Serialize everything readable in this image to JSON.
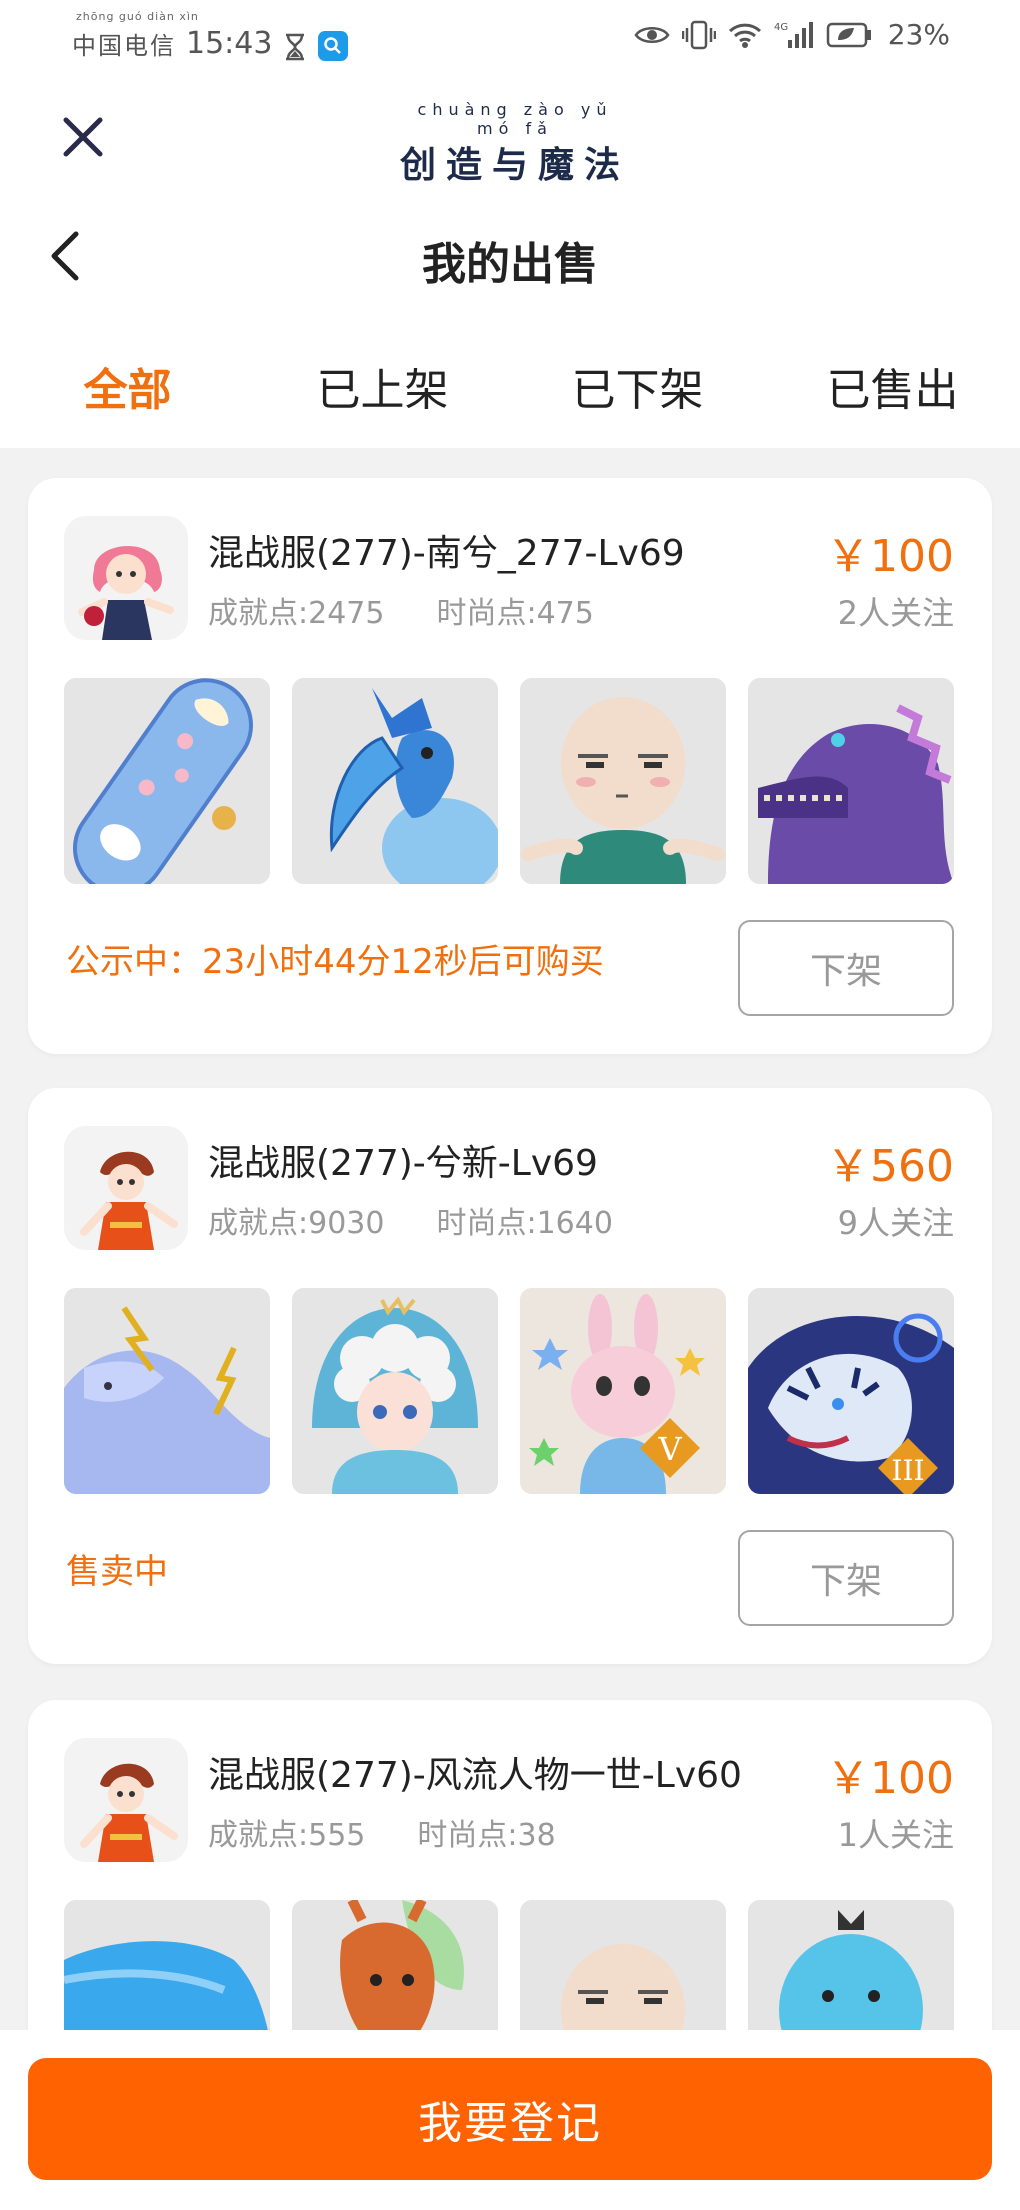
{
  "status_bar": {
    "carrier_pinyin": "zhōng guó diàn xìn",
    "carrier": "中国电信",
    "time": "15:43",
    "battery": "23%"
  },
  "app": {
    "logo_pinyin": "chuàng zào yǔ mó fǎ",
    "logo_text": "创造与魔法"
  },
  "header": {
    "title": "我的出售"
  },
  "tabs": [
    {
      "label": "全部",
      "active": true
    },
    {
      "label": "已上架",
      "active": false
    },
    {
      "label": "已下架",
      "active": false
    },
    {
      "label": "已售出",
      "active": false
    }
  ],
  "listings": [
    {
      "title": "混战服(277)-南兮_277-Lv69",
      "achievement": "成就点:2475",
      "fashion": "时尚点:475",
      "price": "￥100",
      "followers": "2人关注",
      "status": "公示中：23小时44分12秒后可购买",
      "action": "下架",
      "items": [
        "skateboard-item",
        "blue-bird-item",
        "bald-head-item",
        "purple-dinosaur-item"
      ]
    },
    {
      "title": "混战服(277)-兮新-Lv69",
      "achievement": "成就点:9030",
      "fashion": "时尚点:1640",
      "price": "￥560",
      "followers": "9人关注",
      "status": "售卖中",
      "action": "下架",
      "items": [
        "lightning-horse-item",
        "cloud-girl-item",
        "pink-bunny-item",
        "blue-tiger-item"
      ]
    },
    {
      "title": "混战服(277)-风流人物一世-Lv60",
      "achievement": "成就点:555",
      "fashion": "时尚点:38",
      "price": "￥100",
      "followers": "1人关注",
      "items": [
        "blue-whale-item",
        "dragon-head-item",
        "bald-head-item",
        "blue-bird-pet-item"
      ]
    }
  ],
  "bottom": {
    "register": "我要登记"
  },
  "colors": {
    "accent": "#f07010",
    "button": "#ff6200",
    "muted": "#999999"
  }
}
